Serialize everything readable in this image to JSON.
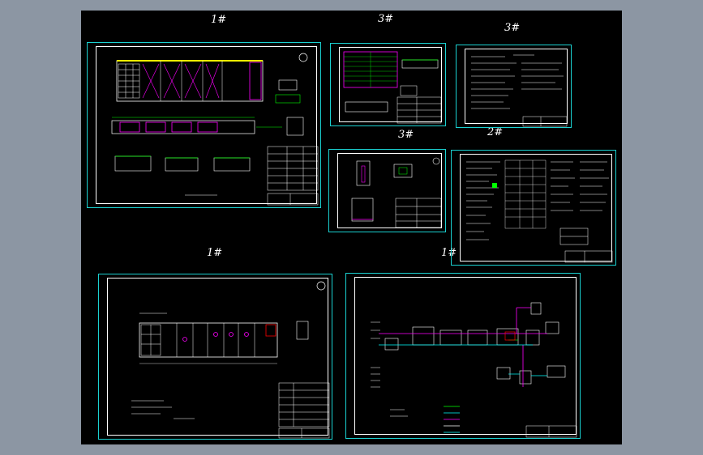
{
  "window": {
    "title": ""
  },
  "sheets": [
    {
      "id": "sheet-a",
      "size_label": "1#"
    },
    {
      "id": "sheet-b",
      "size_label": "3#"
    },
    {
      "id": "sheet-c",
      "size_label": "3#"
    },
    {
      "id": "sheet-d",
      "size_label": "3#"
    },
    {
      "id": "sheet-e",
      "size_label": "2#"
    },
    {
      "id": "sheet-f",
      "size_label": "1#"
    },
    {
      "id": "sheet-g",
      "size_label": "1#"
    }
  ],
  "colors": {
    "background": "#8c96a3",
    "viewport": "#000000",
    "sheet_border": "#1ad1d1",
    "line_white": "#ffffff",
    "line_magenta": "#ff00ff",
    "line_green": "#00ff00",
    "line_yellow": "#ffff00",
    "line_cyan": "#00ffff"
  }
}
